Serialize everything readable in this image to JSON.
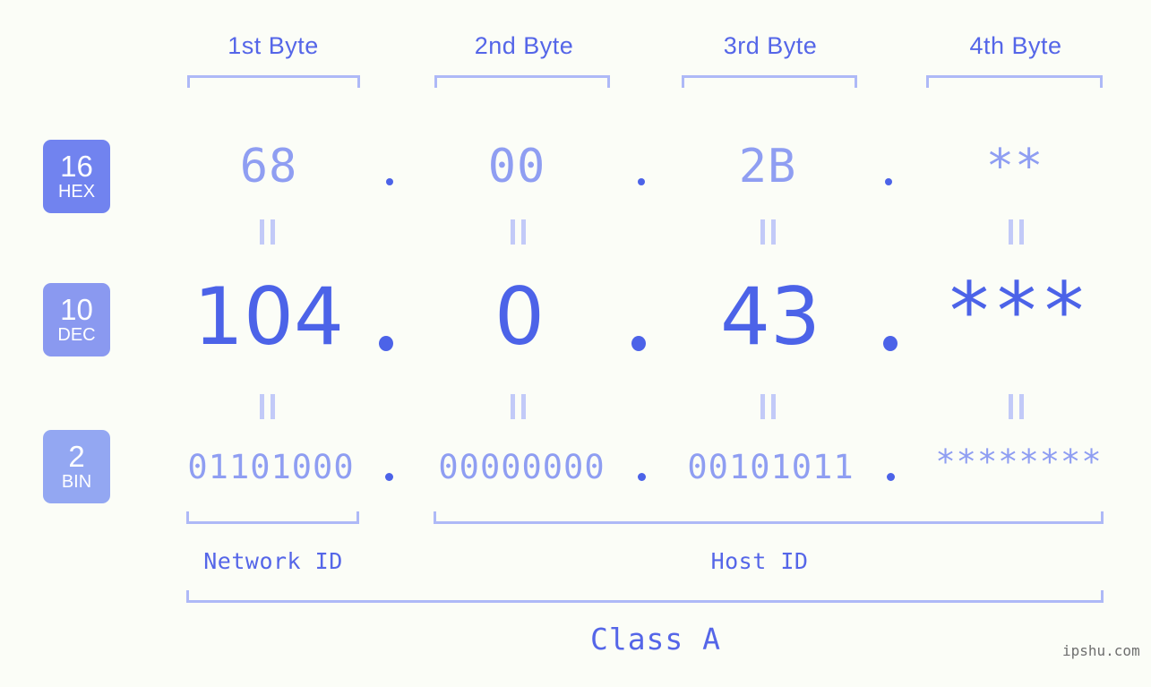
{
  "page": {
    "background": "#fbfdf7",
    "accent_dark": "#4c63e8",
    "accent_mid": "#5566e8",
    "accent_light": "#8f9ef2",
    "bracket_color": "#aeb9f7",
    "watermark": "ipshu.com"
  },
  "byte_headers": [
    {
      "label": "1st Byte"
    },
    {
      "label": "2nd Byte"
    },
    {
      "label": "3rd Byte"
    },
    {
      "label": "4th Byte"
    }
  ],
  "bases": [
    {
      "num": "16",
      "name": "HEX",
      "color": "#7183ef"
    },
    {
      "num": "10",
      "name": "DEC",
      "color": "#8a99f0"
    },
    {
      "num": "2",
      "name": "BIN",
      "color": "#93a7f2"
    }
  ],
  "rows": {
    "hex": {
      "base_num": "16",
      "base_name": "HEX",
      "values": [
        "68",
        "00",
        "2B",
        "**"
      ],
      "separators": [
        ".",
        ".",
        "."
      ]
    },
    "dec": {
      "base_num": "10",
      "base_name": "DEC",
      "values": [
        "104",
        "0",
        "43",
        "***"
      ],
      "separators": [
        ".",
        ".",
        "."
      ]
    },
    "bin": {
      "base_num": "2",
      "base_name": "BIN",
      "values": [
        "01101000",
        "00000000",
        "00101011",
        "********"
      ],
      "separators": [
        ".",
        ".",
        "."
      ]
    }
  },
  "equals_symbol": "=",
  "id_labels": {
    "network": "Network ID",
    "host": "Host ID"
  },
  "class_label": "Class A"
}
